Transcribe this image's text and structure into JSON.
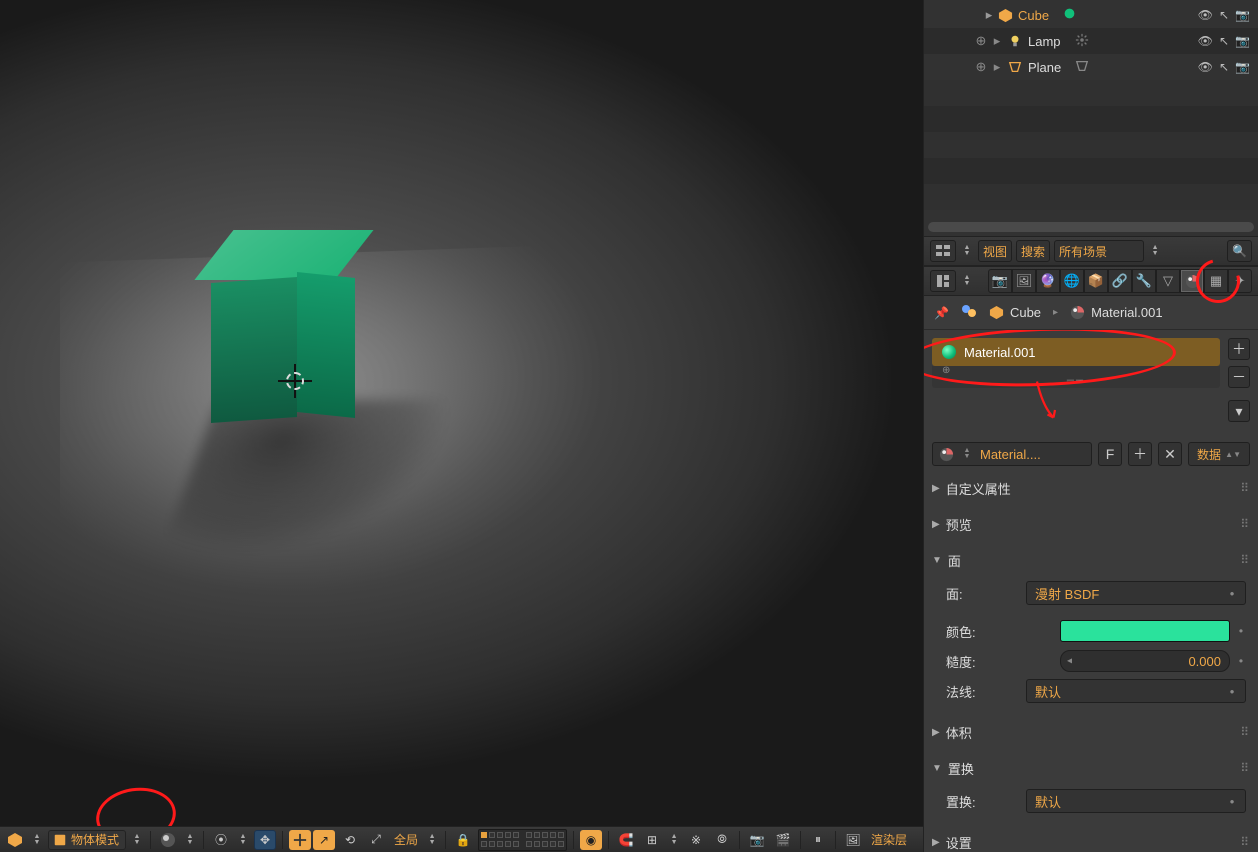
{
  "viewport": {
    "mode_label": "物体模式",
    "orientation_label": "全局",
    "render_layer_label": "渲染层"
  },
  "outliner": {
    "items": [
      {
        "name": "Cube",
        "ind": 60,
        "exp": "▸",
        "icon": "mesh-cube",
        "orange": true,
        "extra_icon": "●",
        "trail_restrict": true
      },
      {
        "name": "Lamp",
        "ind": 60,
        "exp": "⊕",
        "icon": "light",
        "orange": false,
        "extra_icon": "✳",
        "trail_restrict": true
      },
      {
        "name": "Plane",
        "ind": 60,
        "exp": "⊕",
        "icon": "mesh-plane",
        "orange": false,
        "extra_icon": "▽",
        "trail_restrict": true
      }
    ]
  },
  "prop_header": {
    "view_label": "视图",
    "search_label": "搜索",
    "scene_filter_label": "所有场景"
  },
  "breadcrumb": {
    "pin_icon": "pin",
    "ball_icon": "ball",
    "cube_label": "Cube",
    "material_label": "Material.001"
  },
  "material_slot": {
    "name": "Material.001",
    "plus": "＋",
    "minus": "－",
    "special": "▾"
  },
  "material_id": {
    "name": "Material....",
    "fake_user": "F",
    "plus": "＋",
    "close": "✕",
    "data_label": "数据"
  },
  "panels": {
    "custom_props": "自定义属性",
    "preview": "预览",
    "surface": "面",
    "surface_label": "面:",
    "surface_shader": "漫射 BSDF",
    "color_label": "颜色:",
    "rough_label": "糙度:",
    "rough_value": "0.000",
    "normal_label": "法线:",
    "normal_value": "默认",
    "volume": "体积",
    "displacement": "置换",
    "displacement_label": "置换:",
    "displacement_value": "默认",
    "settings": "设置"
  }
}
